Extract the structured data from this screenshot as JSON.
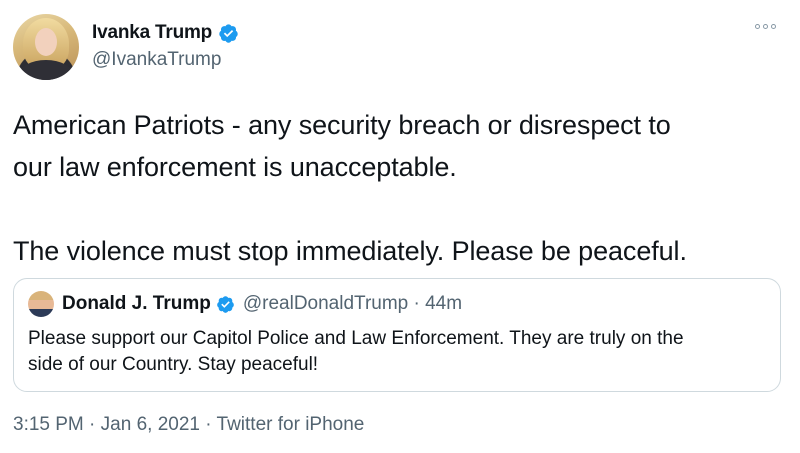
{
  "tweet": {
    "author": {
      "display_name": "Ivanka Trump",
      "handle": "@IvankaTrump",
      "verified_icon": "verified-badge-icon"
    },
    "text_line_1": "American Patriots - any security breach or disrespect to",
    "text_line_2": "our law enforcement is unacceptable.",
    "text_line_3": "The violence must stop immediately. Please be peaceful.",
    "quoted": {
      "display_name": "Donald J. Trump",
      "handle": "@realDonaldTrump · 44m",
      "text_line_1": "Please support our Capitol Police and Law Enforcement. They are truly on the",
      "text_line_2": "side of our Country. Stay peaceful!"
    },
    "meta": {
      "time": "3:15 PM",
      "separator_1": " · ",
      "date": "Jan 6, 2021",
      "separator_2": " · ",
      "source": "Twitter for iPhone"
    }
  },
  "colors": {
    "verified_blue": "#1d9bf0",
    "secondary_text": "#536471",
    "border": "#cfd9de"
  }
}
